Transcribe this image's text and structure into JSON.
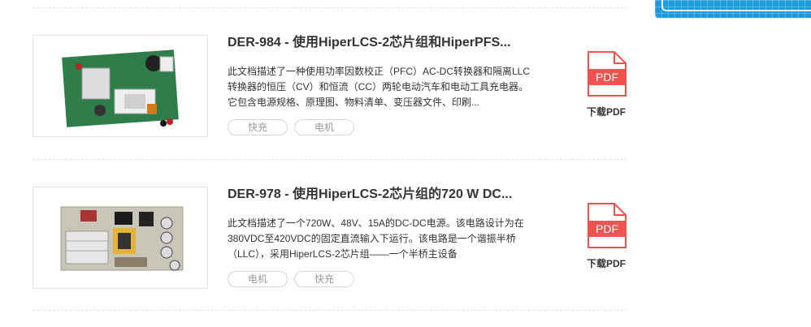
{
  "products": [
    {
      "title": "DER-984 - 使用HiperLCS-2芯片组和HiperPFS...",
      "description": "此文档描述了一种使用功率因数校正（PFC）AC-DC转换器和隔离LLC转换器的恒压（CV）和恒流（CC）两轮电动汽车和电动工具充电器。它包含电源规格、原理图、物料清单、变压器文件、印刷...",
      "tags": [
        "快充",
        "电机"
      ],
      "pdf_label": "下载PDF",
      "pdf_icon_text": "PDF"
    },
    {
      "title": "DER-978 - 使用HiperLCS-2芯片组的720 W DC...",
      "description": "此文档描述了一个720W、48V、15A的DC-DC电源。该电路设计为在380VDC至420VDC的固定直流输入下运行。该电路是一个谐振半桥（LLC），采用HiperLCS-2芯片组——一个半桥主设备",
      "tags": [
        "电机",
        "快充"
      ],
      "pdf_label": "下载PDF",
      "pdf_icon_text": "PDF"
    }
  ],
  "colors": {
    "pdf_red": "#ef5350",
    "banner_blue": "#1f9ad8"
  }
}
